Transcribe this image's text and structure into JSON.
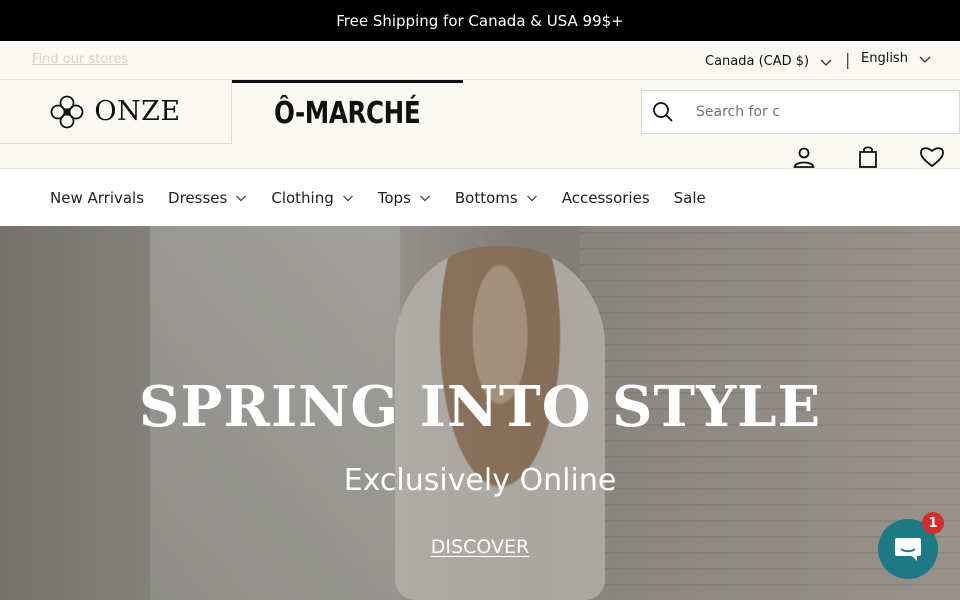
{
  "announcement": "Free Shipping for Canada & USA 99$+",
  "utility": {
    "store_link": "Find our stores",
    "currency": "Canada (CAD $)",
    "divider": "|",
    "language": "English"
  },
  "brands": {
    "onze": "ONZE",
    "omarche": "Ô-MARCHÉ"
  },
  "search": {
    "placeholder": "Search for c"
  },
  "nav": {
    "items": [
      {
        "label": "New Arrivals"
      },
      {
        "label": "Dresses"
      },
      {
        "label": "Clothing"
      },
      {
        "label": "Tops"
      },
      {
        "label": "Bottoms"
      },
      {
        "label": "Accessories"
      },
      {
        "label": "Sale"
      }
    ]
  },
  "hero": {
    "title": "SPRING INTO STYLE",
    "subtitle": "Exclusively Online",
    "cta": "DISCOVER"
  },
  "chat": {
    "badge": "1"
  },
  "colors": {
    "announcement_bg": "#000000",
    "utility_bg": "#fbf9f3",
    "chat_bg": "#1d7a83",
    "badge_bg": "#d72c2c"
  }
}
